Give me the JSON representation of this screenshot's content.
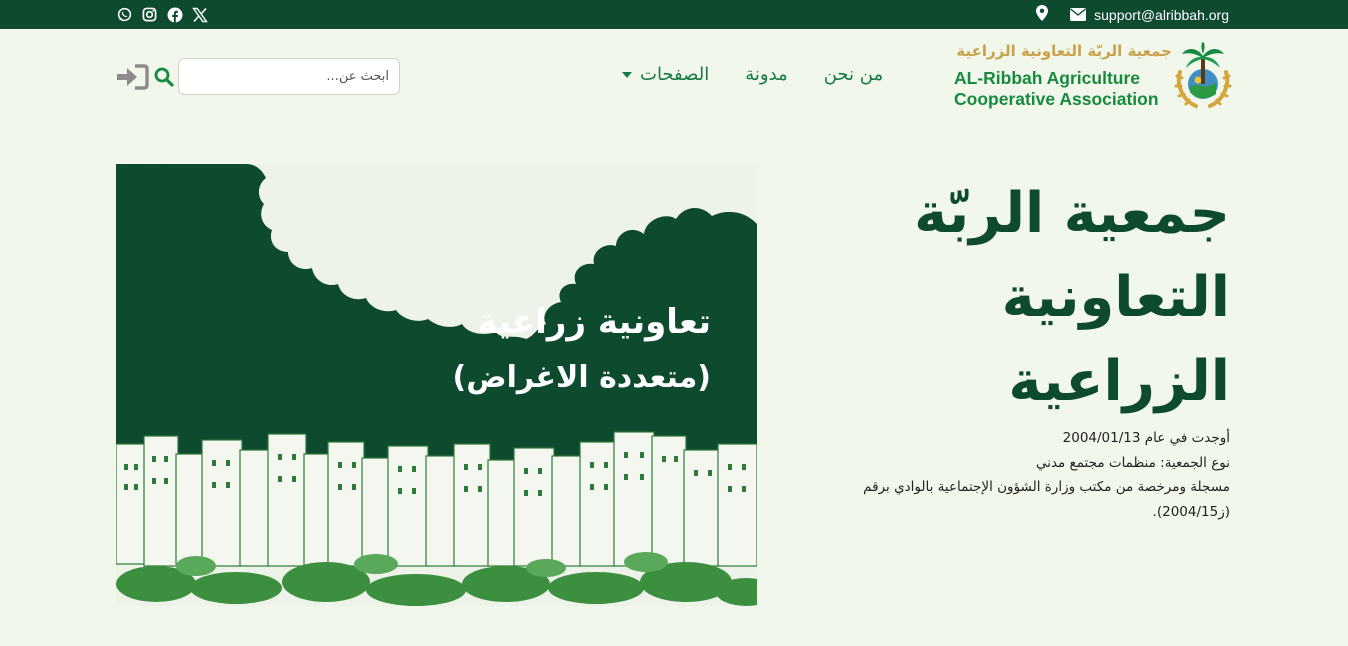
{
  "topbar": {
    "email": "support@alribbah.org",
    "icons": [
      "whatsapp-icon",
      "instagram-icon",
      "facebook-icon",
      "x-twitter-icon",
      "map-marker-icon",
      "envelope-icon"
    ],
    "bg_color": "#0d4a2e"
  },
  "header": {
    "search_placeholder": "ابحث عن...",
    "nav": [
      {
        "label": "من نحن"
      },
      {
        "label": "مدونة"
      },
      {
        "label": "الصفحات"
      }
    ],
    "logo": {
      "arabic_name": "جمعية الربّة التعاونية الزراعية",
      "english_line1": "AL-Ribbah Agriculture",
      "english_line2": "Cooperative Association"
    }
  },
  "hero": {
    "title": "جمعية الربّة التعاونية الزراعية",
    "image_text_line1": "تعاونية زراعية",
    "image_text_line2": "(متعددة الاغراض)",
    "info": [
      "أوجدت في عام 2004/01/13",
      "نوع الجمعية: منظمات مجتمع مدني",
      "مسجلة ومرخصة من مكتب وزارة الشؤون الإجتماعية بالوادي برقم",
      "(ز2004/15)."
    ]
  },
  "colors": {
    "page_bg": "#f1f7ea",
    "dark_green": "#0d4a2e",
    "nav_green": "#167a46",
    "gold": "#c9a24a"
  }
}
